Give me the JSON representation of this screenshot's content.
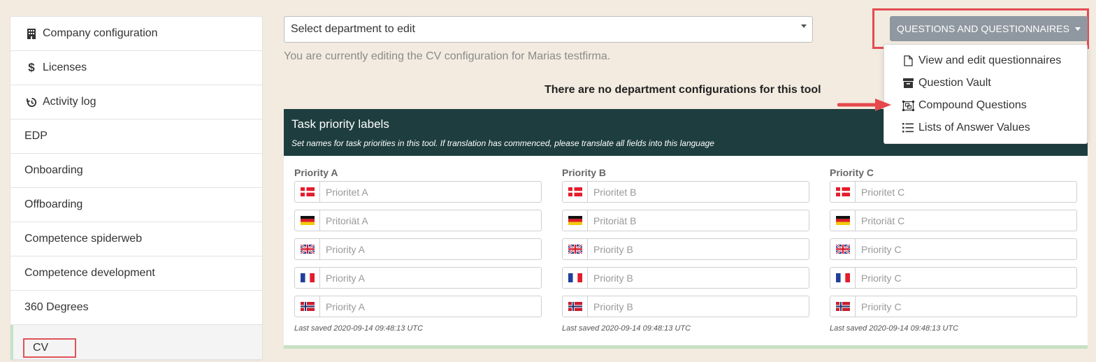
{
  "sidebar": {
    "items": [
      {
        "label": "Company configuration",
        "icon": "building-icon"
      },
      {
        "label": "Licenses",
        "icon": "dollar-icon"
      },
      {
        "label": "Activity log",
        "icon": "history-icon"
      },
      {
        "label": "EDP"
      },
      {
        "label": "Onboarding"
      },
      {
        "label": "Offboarding"
      },
      {
        "label": "Competence spiderweb"
      },
      {
        "label": "Competence development"
      },
      {
        "label": "360 Degrees"
      },
      {
        "label": "CV",
        "active": true
      }
    ]
  },
  "department_select": {
    "value": "Select department to edit"
  },
  "editing_notice": "You are currently editing the CV configuration for Marias testfirma.",
  "no_dept_notice": "There are no department configurations for this tool",
  "dropdown": {
    "button_label": "QUESTIONS AND QUESTIONNAIRES",
    "items": [
      {
        "label": "View and edit questionnaires",
        "icon": "file-icon"
      },
      {
        "label": "Question Vault",
        "icon": "archive-icon"
      },
      {
        "label": "Compound Questions",
        "icon": "object-group-icon"
      },
      {
        "label": "Lists of Answer Values",
        "icon": "list-icon"
      }
    ]
  },
  "panel": {
    "title": "Task priority labels",
    "subtitle": "Set names for task priorities in this tool. If translation has commenced, please translate all fields into this language",
    "columns": [
      {
        "label": "Priority A",
        "fields": [
          {
            "flag": "dk",
            "placeholder": "Prioritet A"
          },
          {
            "flag": "de",
            "placeholder": "Pritoriät A"
          },
          {
            "flag": "gb",
            "placeholder": "Priority A"
          },
          {
            "flag": "fr",
            "placeholder": "Priority A"
          },
          {
            "flag": "no",
            "placeholder": "Priority A"
          }
        ],
        "saved": "Last saved 2020-09-14 09:48:13 UTC"
      },
      {
        "label": "Priority B",
        "fields": [
          {
            "flag": "dk",
            "placeholder": "Prioritet B"
          },
          {
            "flag": "de",
            "placeholder": "Pritoriät B"
          },
          {
            "flag": "gb",
            "placeholder": "Priority B"
          },
          {
            "flag": "fr",
            "placeholder": "Priority B"
          },
          {
            "flag": "no",
            "placeholder": "Priority B"
          }
        ],
        "saved": "Last saved 2020-09-14 09:48:13 UTC"
      },
      {
        "label": "Priority C",
        "fields": [
          {
            "flag": "dk",
            "placeholder": "Prioritet C"
          },
          {
            "flag": "de",
            "placeholder": "Pritoriät C"
          },
          {
            "flag": "gb",
            "placeholder": "Priority C"
          },
          {
            "flag": "fr",
            "placeholder": "Priority C"
          },
          {
            "flag": "no",
            "placeholder": "Priority C"
          }
        ],
        "saved": "Last saved 2020-09-14 09:48:13 UTC"
      }
    ]
  },
  "colors": {
    "background": "#f3ebe0",
    "panel_header": "#1e3d3f",
    "button": "#8f98a1",
    "highlight": "#e34b52",
    "active_accent": "#c7e0c5"
  }
}
